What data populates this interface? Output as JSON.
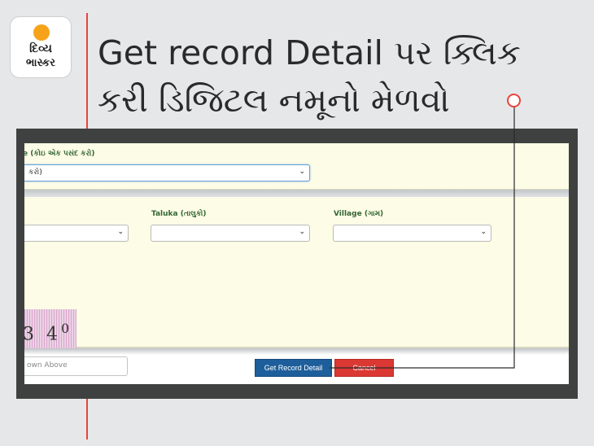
{
  "brand": {
    "logo_line1": "દિવ્ય",
    "logo_line2": "ભાસ્કર"
  },
  "headline": {
    "text": "Get record Detail પર ક્લિક\nકરી ડિજિટલ નમૂનો મેળવો"
  },
  "form": {
    "top_label": "e (કોઇ એક પસંદ કરો)",
    "top_select_value": "કરો)",
    "taluka_label": "Taluka (તાલુકો)",
    "village_label": "Village (ગામ)",
    "captcha_text": "3 4",
    "captcha_sup": "0",
    "captcha_placeholder": "own Above"
  },
  "buttons": {
    "get_record": "Get Record Detail",
    "cancel": "Cancel"
  },
  "colors": {
    "accent": "#e8433b",
    "get_button": "#1d5e9b",
    "cancel_button": "#db3833"
  }
}
